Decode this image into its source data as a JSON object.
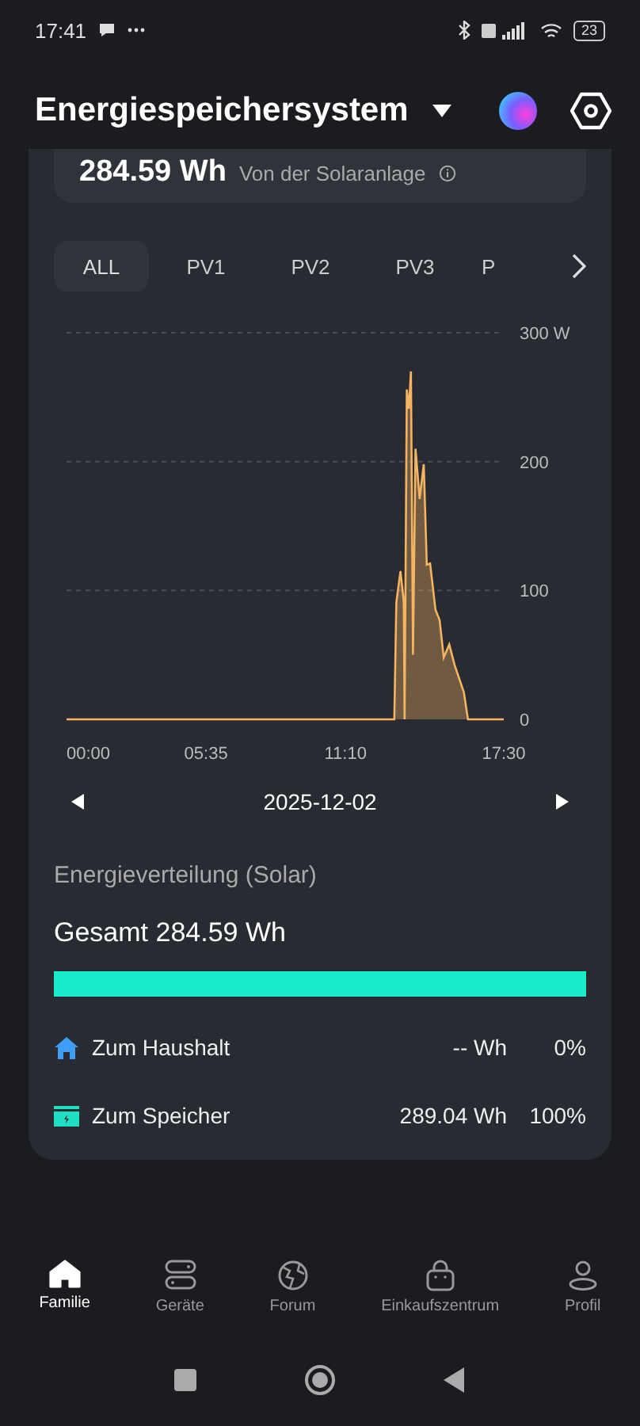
{
  "status_bar": {
    "time": "17:41",
    "battery": "23"
  },
  "header": {
    "title": "Energiespeichersystem"
  },
  "summary": {
    "value": "284.59 Wh",
    "label": "Von der Solaranlage"
  },
  "tabs": [
    {
      "label": "ALL",
      "selected": true
    },
    {
      "label": "PV1",
      "selected": false
    },
    {
      "label": "PV2",
      "selected": false
    },
    {
      "label": "PV3",
      "selected": false
    },
    {
      "label": "P",
      "selected": false
    }
  ],
  "chart_data": {
    "type": "area",
    "xlim": [
      0,
      1050
    ],
    "ylim": [
      0,
      300
    ],
    "xticks": [
      {
        "value": 0,
        "label": "00:00"
      },
      {
        "value": 335,
        "label": "05:35"
      },
      {
        "value": 670,
        "label": "11:10"
      },
      {
        "value": 1050,
        "label": "17:30"
      }
    ],
    "yticks": [
      {
        "value": 0,
        "label": "0"
      },
      {
        "value": 100,
        "label": "100"
      },
      {
        "value": 200,
        "label": "200"
      },
      {
        "value": 300,
        "label": "300 W"
      }
    ],
    "x": [
      0,
      787,
      792,
      802,
      810,
      812,
      817,
      822,
      827,
      832,
      838,
      848,
      858,
      865,
      873,
      886,
      896,
      906,
      919,
      932,
      954,
      964,
      1050
    ],
    "series": [
      {
        "color": "#f5b461",
        "values": [
          0,
          0,
          91,
          115,
          91,
          0,
          256,
          241,
          270,
          50,
          210,
          171,
          198,
          120,
          121,
          85,
          77,
          48,
          58,
          42,
          21,
          0,
          0
        ]
      }
    ]
  },
  "date_nav": {
    "date": "2025-12-02"
  },
  "distribution": {
    "title": "Energieverteilung (Solar)",
    "total": "Gesamt 284.59 Wh",
    "level": 1,
    "rows": [
      {
        "kind": "household",
        "label": "Zum Haushalt",
        "amount": "-- Wh",
        "percent": "0%"
      },
      {
        "kind": "storage",
        "label": "Zum Speicher",
        "amount": "289.04 Wh",
        "percent": "100%"
      }
    ]
  },
  "bottom_nav": [
    {
      "kind": "home",
      "label": "Familie",
      "selected": true
    },
    {
      "kind": "devices",
      "label": "Geräte",
      "selected": false
    },
    {
      "kind": "forum",
      "label": "Forum",
      "selected": false
    },
    {
      "kind": "shop",
      "label": "Einkaufszentrum",
      "selected": false
    },
    {
      "kind": "profile",
      "label": "Profil",
      "selected": false
    }
  ]
}
